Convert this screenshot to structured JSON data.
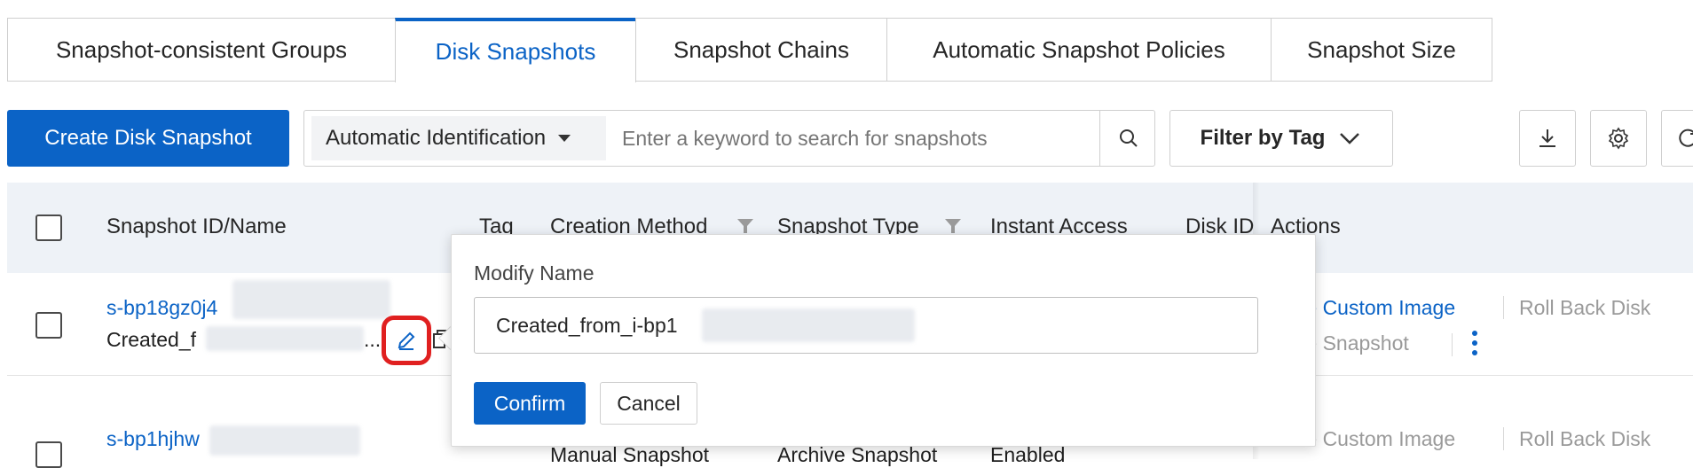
{
  "tabs": [
    {
      "label": "Snapshot-consistent Groups",
      "active": false
    },
    {
      "label": "Disk Snapshots",
      "active": true
    },
    {
      "label": "Snapshot Chains",
      "active": false
    },
    {
      "label": "Automatic Snapshot Policies",
      "active": false
    },
    {
      "label": "Snapshot Size",
      "active": false
    }
  ],
  "toolbar": {
    "create_label": "Create Disk Snapshot",
    "search_mode": "Automatic Identification",
    "search_placeholder": "Enter a keyword to search for snapshots",
    "filter_label": "Filter by Tag"
  },
  "table": {
    "headers": [
      "Snapshot ID/Name",
      "Tag",
      "Creation Method",
      "Snapshot Type",
      "Instant Access",
      "Disk ID",
      "Actions"
    ],
    "rows": [
      {
        "id": "s-bp18gz0j4",
        "name": "Created_f",
        "name_ellipsis": "...",
        "actions": [
          "te Custom Image",
          "Roll Back Disk",
          "te Snapshot"
        ]
      },
      {
        "id": "s-bp1hjhw",
        "creation_method": "Manual Snapshot",
        "snapshot_type": "Archive Snapshot",
        "instant_access": "Enabled",
        "actions": [
          "te Custom Image",
          "Roll Back Disk"
        ]
      }
    ]
  },
  "popover": {
    "title": "Modify Name",
    "input_value": "Created_from_i-bp1",
    "confirm_label": "Confirm",
    "cancel_label": "Cancel"
  },
  "colors": {
    "accent": "#0b63c6",
    "highlight": "#e02020"
  }
}
